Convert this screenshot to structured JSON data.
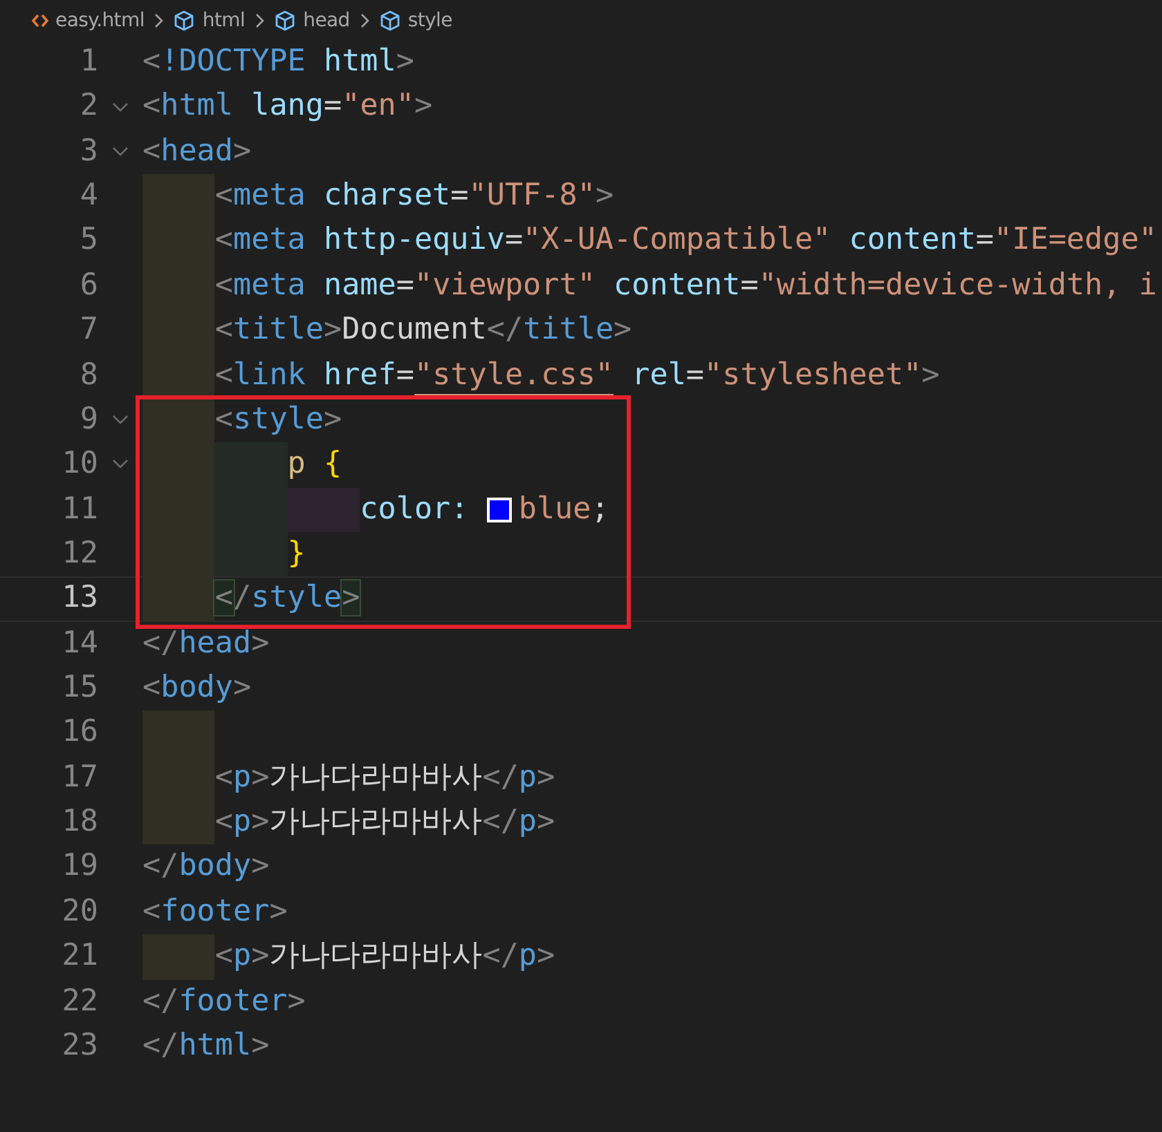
{
  "breadcrumb": [
    {
      "kind": "file",
      "label": "easy.html"
    },
    {
      "kind": "element",
      "label": "html"
    },
    {
      "kind": "element",
      "label": "head"
    },
    {
      "kind": "element",
      "label": "style"
    }
  ],
  "lines": [
    {
      "number": "1",
      "tokens": [
        {
          "kind": "punct",
          "text": "<"
        },
        {
          "kind": "tag",
          "text": "!DOCTYPE "
        },
        {
          "kind": "attr",
          "text": "html"
        },
        {
          "kind": "punct",
          "text": ">"
        }
      ]
    },
    {
      "number": "2",
      "foldable": true,
      "tokens": [
        {
          "kind": "punct",
          "text": "<"
        },
        {
          "kind": "tag",
          "text": "html "
        },
        {
          "kind": "attr",
          "text": "lang"
        },
        {
          "kind": "text",
          "text": "="
        },
        {
          "kind": "string",
          "text": "\"en\""
        },
        {
          "kind": "punct",
          "text": ">"
        }
      ]
    },
    {
      "number": "3",
      "foldable": true,
      "tokens": [
        {
          "kind": "punct",
          "text": "<"
        },
        {
          "kind": "tag",
          "text": "head"
        },
        {
          "kind": "punct",
          "text": ">"
        }
      ],
      "children": [
        {
          "number": "4",
          "tokens": [
            {
              "kind": "punct",
              "text": "<"
            },
            {
              "kind": "tag",
              "text": "meta "
            },
            {
              "kind": "attr",
              "text": "charset"
            },
            {
              "kind": "text",
              "text": "="
            },
            {
              "kind": "string",
              "text": "\"UTF-8\""
            },
            {
              "kind": "punct",
              "text": ">"
            }
          ]
        },
        {
          "number": "5",
          "tokens": [
            {
              "kind": "punct",
              "text": "<"
            },
            {
              "kind": "tag",
              "text": "meta "
            },
            {
              "kind": "attr",
              "text": "http-equiv"
            },
            {
              "kind": "text",
              "text": "="
            },
            {
              "kind": "string",
              "text": "\"X-UA-Compatible\" "
            },
            {
              "kind": "attr",
              "text": "content"
            },
            {
              "kind": "text",
              "text": "="
            },
            {
              "kind": "string",
              "text": "\"IE=edge\""
            }
          ]
        },
        {
          "number": "6",
          "tokens": [
            {
              "kind": "punct",
              "text": "<"
            },
            {
              "kind": "tag",
              "text": "meta "
            },
            {
              "kind": "attr",
              "text": "name"
            },
            {
              "kind": "text",
              "text": "="
            },
            {
              "kind": "string",
              "text": "\"viewport\" "
            },
            {
              "kind": "attr",
              "text": "content"
            },
            {
              "kind": "text",
              "text": "="
            },
            {
              "kind": "string",
              "text": "\"width=device-width, i"
            }
          ]
        },
        {
          "number": "7",
          "tokens": [
            {
              "kind": "punct",
              "text": "<"
            },
            {
              "kind": "tag",
              "text": "title"
            },
            {
              "kind": "punct",
              "text": ">"
            },
            {
              "kind": "text",
              "text": "Document"
            },
            {
              "kind": "punct",
              "text": "</"
            },
            {
              "kind": "tag",
              "text": "title"
            },
            {
              "kind": "punct",
              "text": ">"
            }
          ]
        },
        {
          "number": "8",
          "tokens": [
            {
              "kind": "punct",
              "text": "<"
            },
            {
              "kind": "tag",
              "text": "link "
            },
            {
              "kind": "attr",
              "text": "href"
            },
            {
              "kind": "text",
              "text": "="
            },
            {
              "kind": "link",
              "text": "\"style.css\""
            },
            {
              "kind": "attr",
              "text": " rel"
            },
            {
              "kind": "text",
              "text": "="
            },
            {
              "kind": "string",
              "text": "\"stylesheet\""
            },
            {
              "kind": "punct",
              "text": ">"
            }
          ]
        },
        {
          "number": "9",
          "foldable": true,
          "boxed": true,
          "tokens": [
            {
              "kind": "punct",
              "text": "<"
            },
            {
              "kind": "tag",
              "text": "style"
            },
            {
              "kind": "punct",
              "text": ">"
            }
          ],
          "children": [
            {
              "number": "10",
              "foldable": true,
              "boxed": true,
              "tokens": [
                {
                  "kind": "prop",
                  "text": "p "
                },
                {
                  "kind": "bracket",
                  "text": "{"
                }
              ],
              "children": [
                {
                  "number": "11",
                  "boxed": true,
                  "tokens": [
                    {
                      "kind": "attr",
                      "text": "color: "
                    },
                    {
                      "kind": "swatch",
                      "color": "#0000ff"
                    },
                    {
                      "kind": "string",
                      "text": "blue"
                    },
                    {
                      "kind": "text",
                      "text": ";"
                    }
                  ]
                }
              ]
            },
            {
              "number": "12",
              "boxed": true,
              "tokens": [
                {
                  "kind": "bracket",
                  "text": "}"
                }
              ]
            }
          ]
        },
        {
          "number": "13",
          "current": true,
          "boxed": true,
          "tokens": [
            {
              "kind": "match",
              "text": "<"
            },
            {
              "kind": "punct",
              "text": "/"
            },
            {
              "kind": "tag",
              "text": "style"
            },
            {
              "kind": "match",
              "text": ">"
            }
          ]
        }
      ]
    },
    {
      "number": "14",
      "tokens": [
        {
          "kind": "punct",
          "text": "</"
        },
        {
          "kind": "tag",
          "text": "head"
        },
        {
          "kind": "punct",
          "text": ">"
        }
      ]
    },
    {
      "number": "15",
      "tokens": [
        {
          "kind": "punct",
          "text": "<"
        },
        {
          "kind": "tag",
          "text": "body"
        },
        {
          "kind": "punct",
          "text": ">"
        }
      ],
      "children": [
        {
          "number": "16"
        },
        {
          "number": "17",
          "tokens": [
            {
              "kind": "punct",
              "text": "<"
            },
            {
              "kind": "tag",
              "text": "p"
            },
            {
              "kind": "punct",
              "text": ">"
            },
            {
              "kind": "text",
              "text": "가나다라마바사"
            },
            {
              "kind": "punct",
              "text": "</"
            },
            {
              "kind": "tag",
              "text": "p"
            },
            {
              "kind": "punct",
              "text": ">"
            }
          ]
        },
        {
          "number": "18",
          "tokens": [
            {
              "kind": "punct",
              "text": "<"
            },
            {
              "kind": "tag",
              "text": "p"
            },
            {
              "kind": "punct",
              "text": ">"
            },
            {
              "kind": "text",
              "text": "가나다라마바사"
            },
            {
              "kind": "punct",
              "text": "</"
            },
            {
              "kind": "tag",
              "text": "p"
            },
            {
              "kind": "punct",
              "text": ">"
            }
          ]
        }
      ]
    },
    {
      "number": "19",
      "tokens": [
        {
          "kind": "punct",
          "text": "</"
        },
        {
          "kind": "tag",
          "text": "body"
        },
        {
          "kind": "punct",
          "text": ">"
        }
      ]
    },
    {
      "number": "20",
      "tokens": [
        {
          "kind": "punct",
          "text": "<"
        },
        {
          "kind": "tag",
          "text": "footer"
        },
        {
          "kind": "punct",
          "text": ">"
        }
      ],
      "children": [
        {
          "number": "21",
          "tokens": [
            {
              "kind": "punct",
              "text": "<"
            },
            {
              "kind": "tag",
              "text": "p"
            },
            {
              "kind": "punct",
              "text": ">"
            },
            {
              "kind": "text",
              "text": "가나다라마바사"
            },
            {
              "kind": "punct",
              "text": "</"
            },
            {
              "kind": "tag",
              "text": "p"
            },
            {
              "kind": "punct",
              "text": ">"
            }
          ]
        }
      ]
    },
    {
      "number": "22",
      "tokens": [
        {
          "kind": "punct",
          "text": "</"
        },
        {
          "kind": "tag",
          "text": "footer"
        },
        {
          "kind": "punct",
          "text": ">"
        }
      ]
    },
    {
      "number": "23",
      "tokens": [
        {
          "kind": "punct",
          "text": "</"
        },
        {
          "kind": "tag",
          "text": "html"
        },
        {
          "kind": "punct",
          "text": ">"
        }
      ]
    }
  ]
}
